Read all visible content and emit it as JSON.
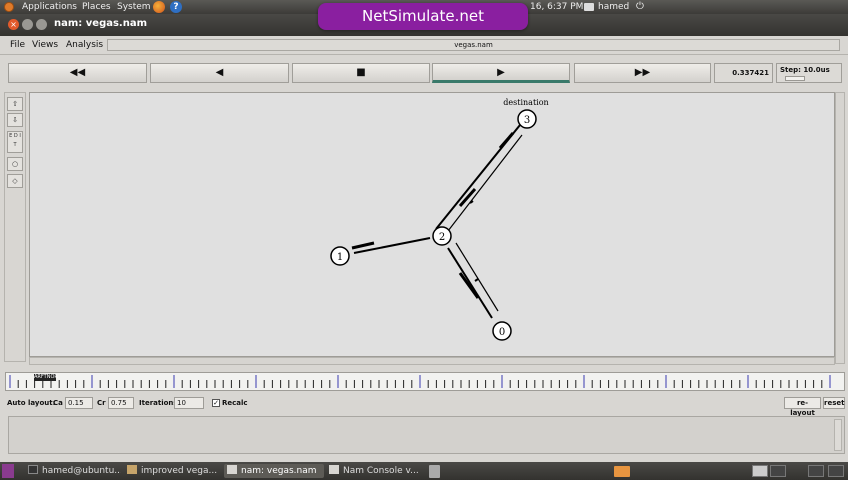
{
  "system_bar": {
    "menus": [
      "Applications",
      "Places",
      "System"
    ],
    "clock": "16, 6:37 PM",
    "user": "hamed"
  },
  "banner": {
    "text": "NetSimulate.net"
  },
  "window": {
    "title": "nam: vegas.nam"
  },
  "menubar": {
    "file": "File",
    "views": "Views",
    "analysis": "Analysis",
    "filename": "vegas.nam"
  },
  "playback": {
    "rewind": "◀◀",
    "back": "◀",
    "stop": "■",
    "play": "▶",
    "forward": "▶▶",
    "time": "0.337421",
    "step_label": "Step: 10.0us"
  },
  "tools": {
    "edit_label": "E D I T"
  },
  "topology": {
    "annotation": "destination",
    "nodes": [
      {
        "id": "3"
      },
      {
        "id": "2"
      },
      {
        "id": "1"
      },
      {
        "id": "0"
      }
    ]
  },
  "timeline": {
    "marker": "ARFTNOR"
  },
  "autolayout": {
    "label": "Auto layout:",
    "ca_label": "Ca",
    "ca_value": "0.15",
    "cr_label": "Cr",
    "cr_value": "0.75",
    "iter_label": "Iterations",
    "iter_value": "10",
    "recalc_label": "Recalc",
    "recalc_check": "✓",
    "relayout_label": "re-layout",
    "reset_label": "reset"
  },
  "taskbar": {
    "items": [
      "hamed@ubuntu...",
      "improved vega...",
      "nam: vegas.nam",
      "Nam Console v..."
    ]
  }
}
